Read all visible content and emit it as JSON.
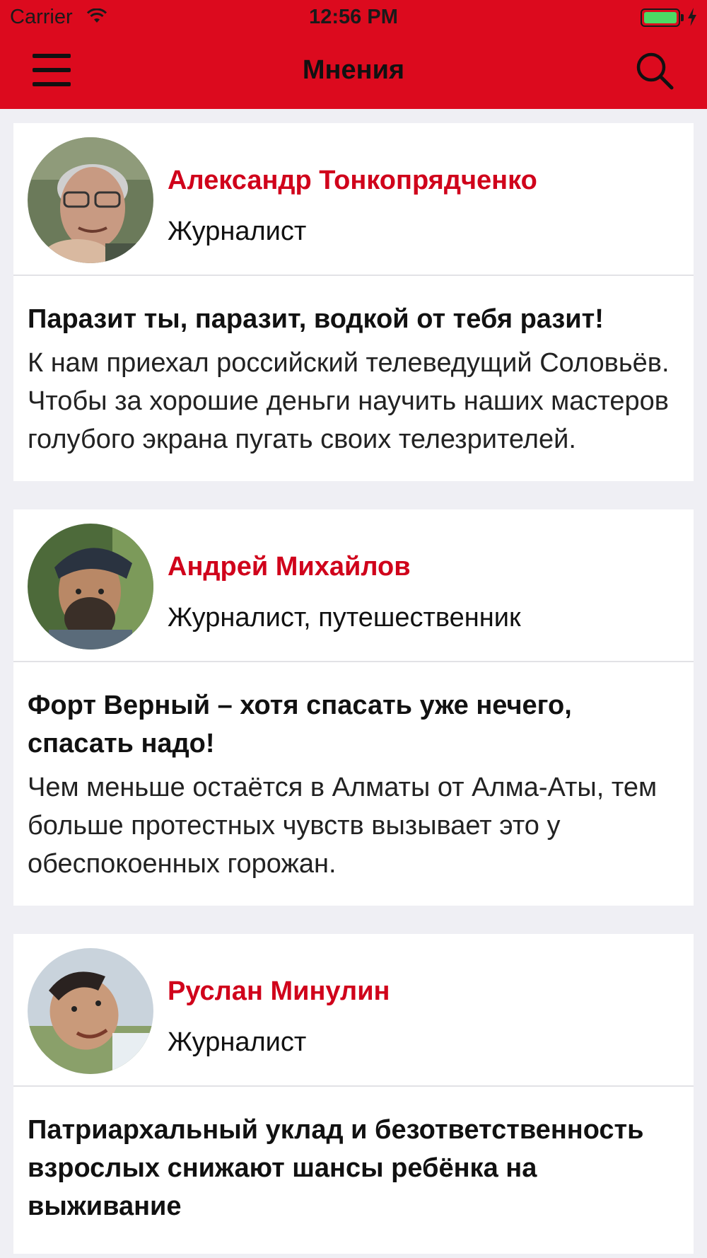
{
  "status_bar": {
    "carrier": "Carrier",
    "time": "12:56 PM",
    "battery_color": "#4cd964"
  },
  "nav": {
    "title": "Мнения",
    "menu_icon": "hamburger-menu-icon",
    "search_icon": "search-icon",
    "background_color": "#dc0a1e"
  },
  "accent_color": "#d0021b",
  "opinions": [
    {
      "author": "Александр Тонкопрядченко",
      "role": "Журналист",
      "avatar": "author-photo",
      "title": "Паразит ты, паразит, водкой от тебя разит!",
      "excerpt": "К нам приехал российский телеведущий Соловьёв. Чтобы за хорошие деньги научить наших мастеров голубого экрана пугать своих телезрителей."
    },
    {
      "author": "Андрей Михайлов",
      "role": "Журналист, путешественник",
      "avatar": "author-photo",
      "title": "Форт Верный – хотя спасать уже нечего, спасать надо!",
      "excerpt": "Чем меньше остаётся в Алматы от Алма-Аты, тем больше протестных чувств вызывает это у обеспокоенных горожан."
    },
    {
      "author": "Руслан Минулин",
      "role": "Журналист",
      "avatar": "author-photo",
      "title": "Патриархальный уклад и безответственность взрослых снижают шансы ребёнка на выживание",
      "excerpt": ""
    }
  ]
}
